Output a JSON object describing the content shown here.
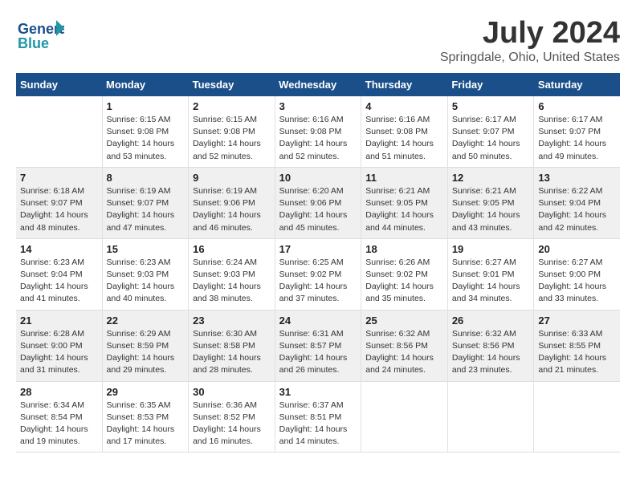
{
  "header": {
    "logo_line1": "General",
    "logo_line2": "Blue",
    "main_title": "July 2024",
    "subtitle": "Springdale, Ohio, United States"
  },
  "calendar": {
    "days_of_week": [
      "Sunday",
      "Monday",
      "Tuesday",
      "Wednesday",
      "Thursday",
      "Friday",
      "Saturday"
    ],
    "weeks": [
      [
        {
          "day": "",
          "content": ""
        },
        {
          "day": "1",
          "content": "Sunrise: 6:15 AM\nSunset: 9:08 PM\nDaylight: 14 hours\nand 53 minutes."
        },
        {
          "day": "2",
          "content": "Sunrise: 6:15 AM\nSunset: 9:08 PM\nDaylight: 14 hours\nand 52 minutes."
        },
        {
          "day": "3",
          "content": "Sunrise: 6:16 AM\nSunset: 9:08 PM\nDaylight: 14 hours\nand 52 minutes."
        },
        {
          "day": "4",
          "content": "Sunrise: 6:16 AM\nSunset: 9:08 PM\nDaylight: 14 hours\nand 51 minutes."
        },
        {
          "day": "5",
          "content": "Sunrise: 6:17 AM\nSunset: 9:07 PM\nDaylight: 14 hours\nand 50 minutes."
        },
        {
          "day": "6",
          "content": "Sunrise: 6:17 AM\nSunset: 9:07 PM\nDaylight: 14 hours\nand 49 minutes."
        }
      ],
      [
        {
          "day": "7",
          "content": "Sunrise: 6:18 AM\nSunset: 9:07 PM\nDaylight: 14 hours\nand 48 minutes."
        },
        {
          "day": "8",
          "content": "Sunrise: 6:19 AM\nSunset: 9:07 PM\nDaylight: 14 hours\nand 47 minutes."
        },
        {
          "day": "9",
          "content": "Sunrise: 6:19 AM\nSunset: 9:06 PM\nDaylight: 14 hours\nand 46 minutes."
        },
        {
          "day": "10",
          "content": "Sunrise: 6:20 AM\nSunset: 9:06 PM\nDaylight: 14 hours\nand 45 minutes."
        },
        {
          "day": "11",
          "content": "Sunrise: 6:21 AM\nSunset: 9:05 PM\nDaylight: 14 hours\nand 44 minutes."
        },
        {
          "day": "12",
          "content": "Sunrise: 6:21 AM\nSunset: 9:05 PM\nDaylight: 14 hours\nand 43 minutes."
        },
        {
          "day": "13",
          "content": "Sunrise: 6:22 AM\nSunset: 9:04 PM\nDaylight: 14 hours\nand 42 minutes."
        }
      ],
      [
        {
          "day": "14",
          "content": "Sunrise: 6:23 AM\nSunset: 9:04 PM\nDaylight: 14 hours\nand 41 minutes."
        },
        {
          "day": "15",
          "content": "Sunrise: 6:23 AM\nSunset: 9:03 PM\nDaylight: 14 hours\nand 40 minutes."
        },
        {
          "day": "16",
          "content": "Sunrise: 6:24 AM\nSunset: 9:03 PM\nDaylight: 14 hours\nand 38 minutes."
        },
        {
          "day": "17",
          "content": "Sunrise: 6:25 AM\nSunset: 9:02 PM\nDaylight: 14 hours\nand 37 minutes."
        },
        {
          "day": "18",
          "content": "Sunrise: 6:26 AM\nSunset: 9:02 PM\nDaylight: 14 hours\nand 35 minutes."
        },
        {
          "day": "19",
          "content": "Sunrise: 6:27 AM\nSunset: 9:01 PM\nDaylight: 14 hours\nand 34 minutes."
        },
        {
          "day": "20",
          "content": "Sunrise: 6:27 AM\nSunset: 9:00 PM\nDaylight: 14 hours\nand 33 minutes."
        }
      ],
      [
        {
          "day": "21",
          "content": "Sunrise: 6:28 AM\nSunset: 9:00 PM\nDaylight: 14 hours\nand 31 minutes."
        },
        {
          "day": "22",
          "content": "Sunrise: 6:29 AM\nSunset: 8:59 PM\nDaylight: 14 hours\nand 29 minutes."
        },
        {
          "day": "23",
          "content": "Sunrise: 6:30 AM\nSunset: 8:58 PM\nDaylight: 14 hours\nand 28 minutes."
        },
        {
          "day": "24",
          "content": "Sunrise: 6:31 AM\nSunset: 8:57 PM\nDaylight: 14 hours\nand 26 minutes."
        },
        {
          "day": "25",
          "content": "Sunrise: 6:32 AM\nSunset: 8:56 PM\nDaylight: 14 hours\nand 24 minutes."
        },
        {
          "day": "26",
          "content": "Sunrise: 6:32 AM\nSunset: 8:56 PM\nDaylight: 14 hours\nand 23 minutes."
        },
        {
          "day": "27",
          "content": "Sunrise: 6:33 AM\nSunset: 8:55 PM\nDaylight: 14 hours\nand 21 minutes."
        }
      ],
      [
        {
          "day": "28",
          "content": "Sunrise: 6:34 AM\nSunset: 8:54 PM\nDaylight: 14 hours\nand 19 minutes."
        },
        {
          "day": "29",
          "content": "Sunrise: 6:35 AM\nSunset: 8:53 PM\nDaylight: 14 hours\nand 17 minutes."
        },
        {
          "day": "30",
          "content": "Sunrise: 6:36 AM\nSunset: 8:52 PM\nDaylight: 14 hours\nand 16 minutes."
        },
        {
          "day": "31",
          "content": "Sunrise: 6:37 AM\nSunset: 8:51 PM\nDaylight: 14 hours\nand 14 minutes."
        },
        {
          "day": "",
          "content": ""
        },
        {
          "day": "",
          "content": ""
        },
        {
          "day": "",
          "content": ""
        }
      ]
    ]
  }
}
